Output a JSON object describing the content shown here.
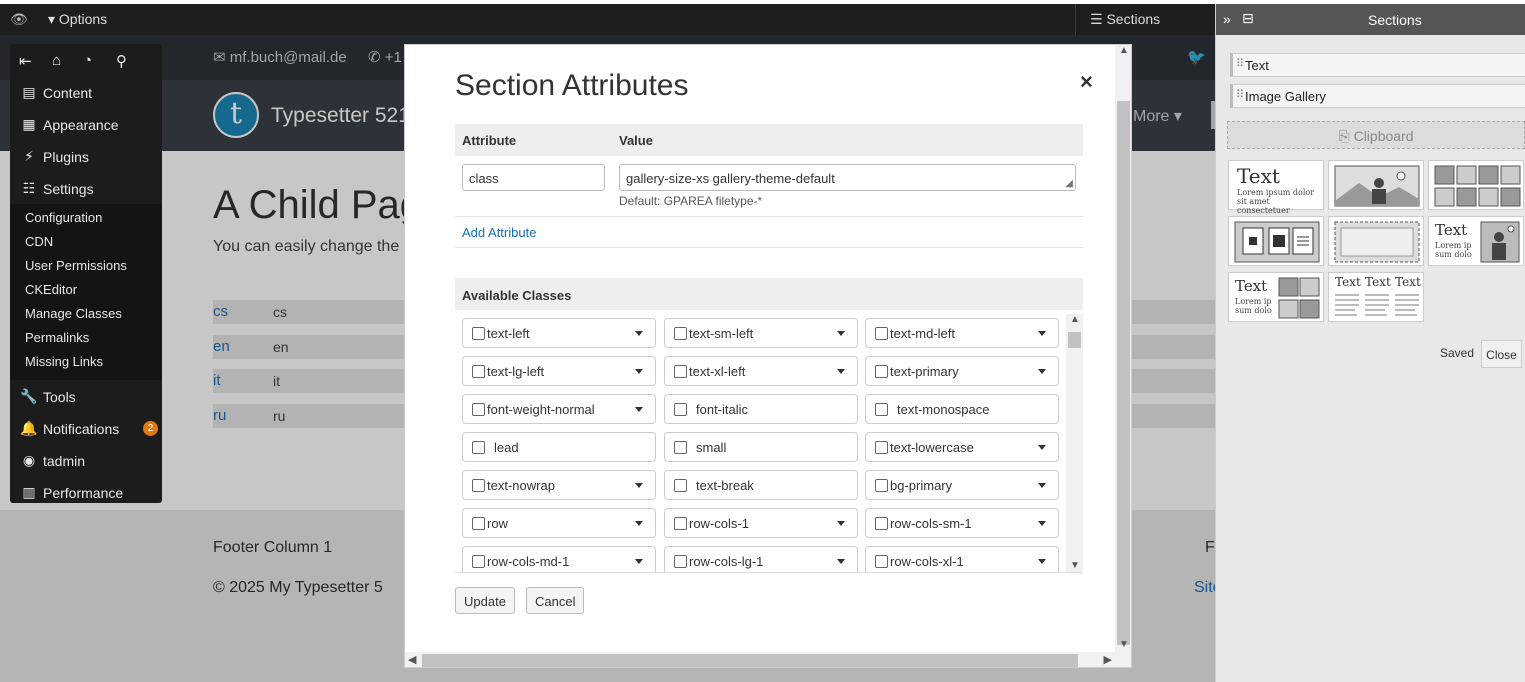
{
  "adminbar": {
    "options_label": "Options",
    "sections_label": "Sections"
  },
  "page": {
    "email": "mf.buch@mail.de",
    "phone": "+1",
    "site_name": "Typesetter 521",
    "nav_more": "More",
    "title": "A Child Pag",
    "subtitle": "You can easily change the a",
    "languages": [
      {
        "code": "cs",
        "value": "cs"
      },
      {
        "code": "en",
        "value": "en"
      },
      {
        "code": "it",
        "value": "it"
      },
      {
        "code": "ru",
        "value": "ru"
      }
    ],
    "footer": {
      "col1": "Footer Column 1",
      "copyright": "© 2025 My Typesetter 5",
      "right_col": "Fo",
      "right_link": "Site"
    }
  },
  "admin_menu": {
    "items": [
      {
        "label": "Content"
      },
      {
        "label": "Appearance"
      },
      {
        "label": "Plugins"
      },
      {
        "label": "Settings"
      }
    ],
    "settings_sub": [
      "Configuration",
      "CDN",
      "User Permissions",
      "CKEditor",
      "Manage Classes",
      "Permalinks",
      "Missing Links"
    ],
    "items2": [
      {
        "label": "Tools"
      },
      {
        "label": "Notifications",
        "badge": "2"
      },
      {
        "label": "tadmin"
      },
      {
        "label": "Performance"
      }
    ]
  },
  "modal": {
    "title": "Section Attributes",
    "close": "×",
    "col_attribute": "Attribute",
    "col_value": "Value",
    "attr_name": "class",
    "attr_value": "gallery-size-xs gallery-theme-default",
    "attr_default": "Default: GPAREA filetype-*",
    "add_attribute": "Add Attribute",
    "available_classes": "Available Classes",
    "classes": [
      [
        "text-left",
        "text-sm-left",
        "text-md-left"
      ],
      [
        "text-lg-left",
        "text-xl-left",
        "text-primary"
      ],
      [
        "font-weight-normal",
        "font-italic",
        "text-monospace"
      ],
      [
        "lead",
        "small",
        "text-lowercase"
      ],
      [
        "text-nowrap",
        "text-break",
        "bg-primary"
      ],
      [
        "row",
        "row-cols-1",
        "row-cols-sm-1"
      ],
      [
        "row-cols-md-1",
        "row-cols-lg-1",
        "row-cols-xl-1"
      ]
    ],
    "update": "Update",
    "cancel": "Cancel"
  },
  "panel": {
    "title": "Sections",
    "sections": [
      "Text",
      "Image Gallery"
    ],
    "clipboard": "Clipboard",
    "tile_texts": {
      "big": "Text",
      "lorem1": "Lorem ipsum dolor",
      "lorem2": "sit amet consectetuer",
      "lorem_short1": "Lorem ip",
      "lorem_short2": "sum dolo"
    },
    "saved": "Saved",
    "close": "Close"
  }
}
